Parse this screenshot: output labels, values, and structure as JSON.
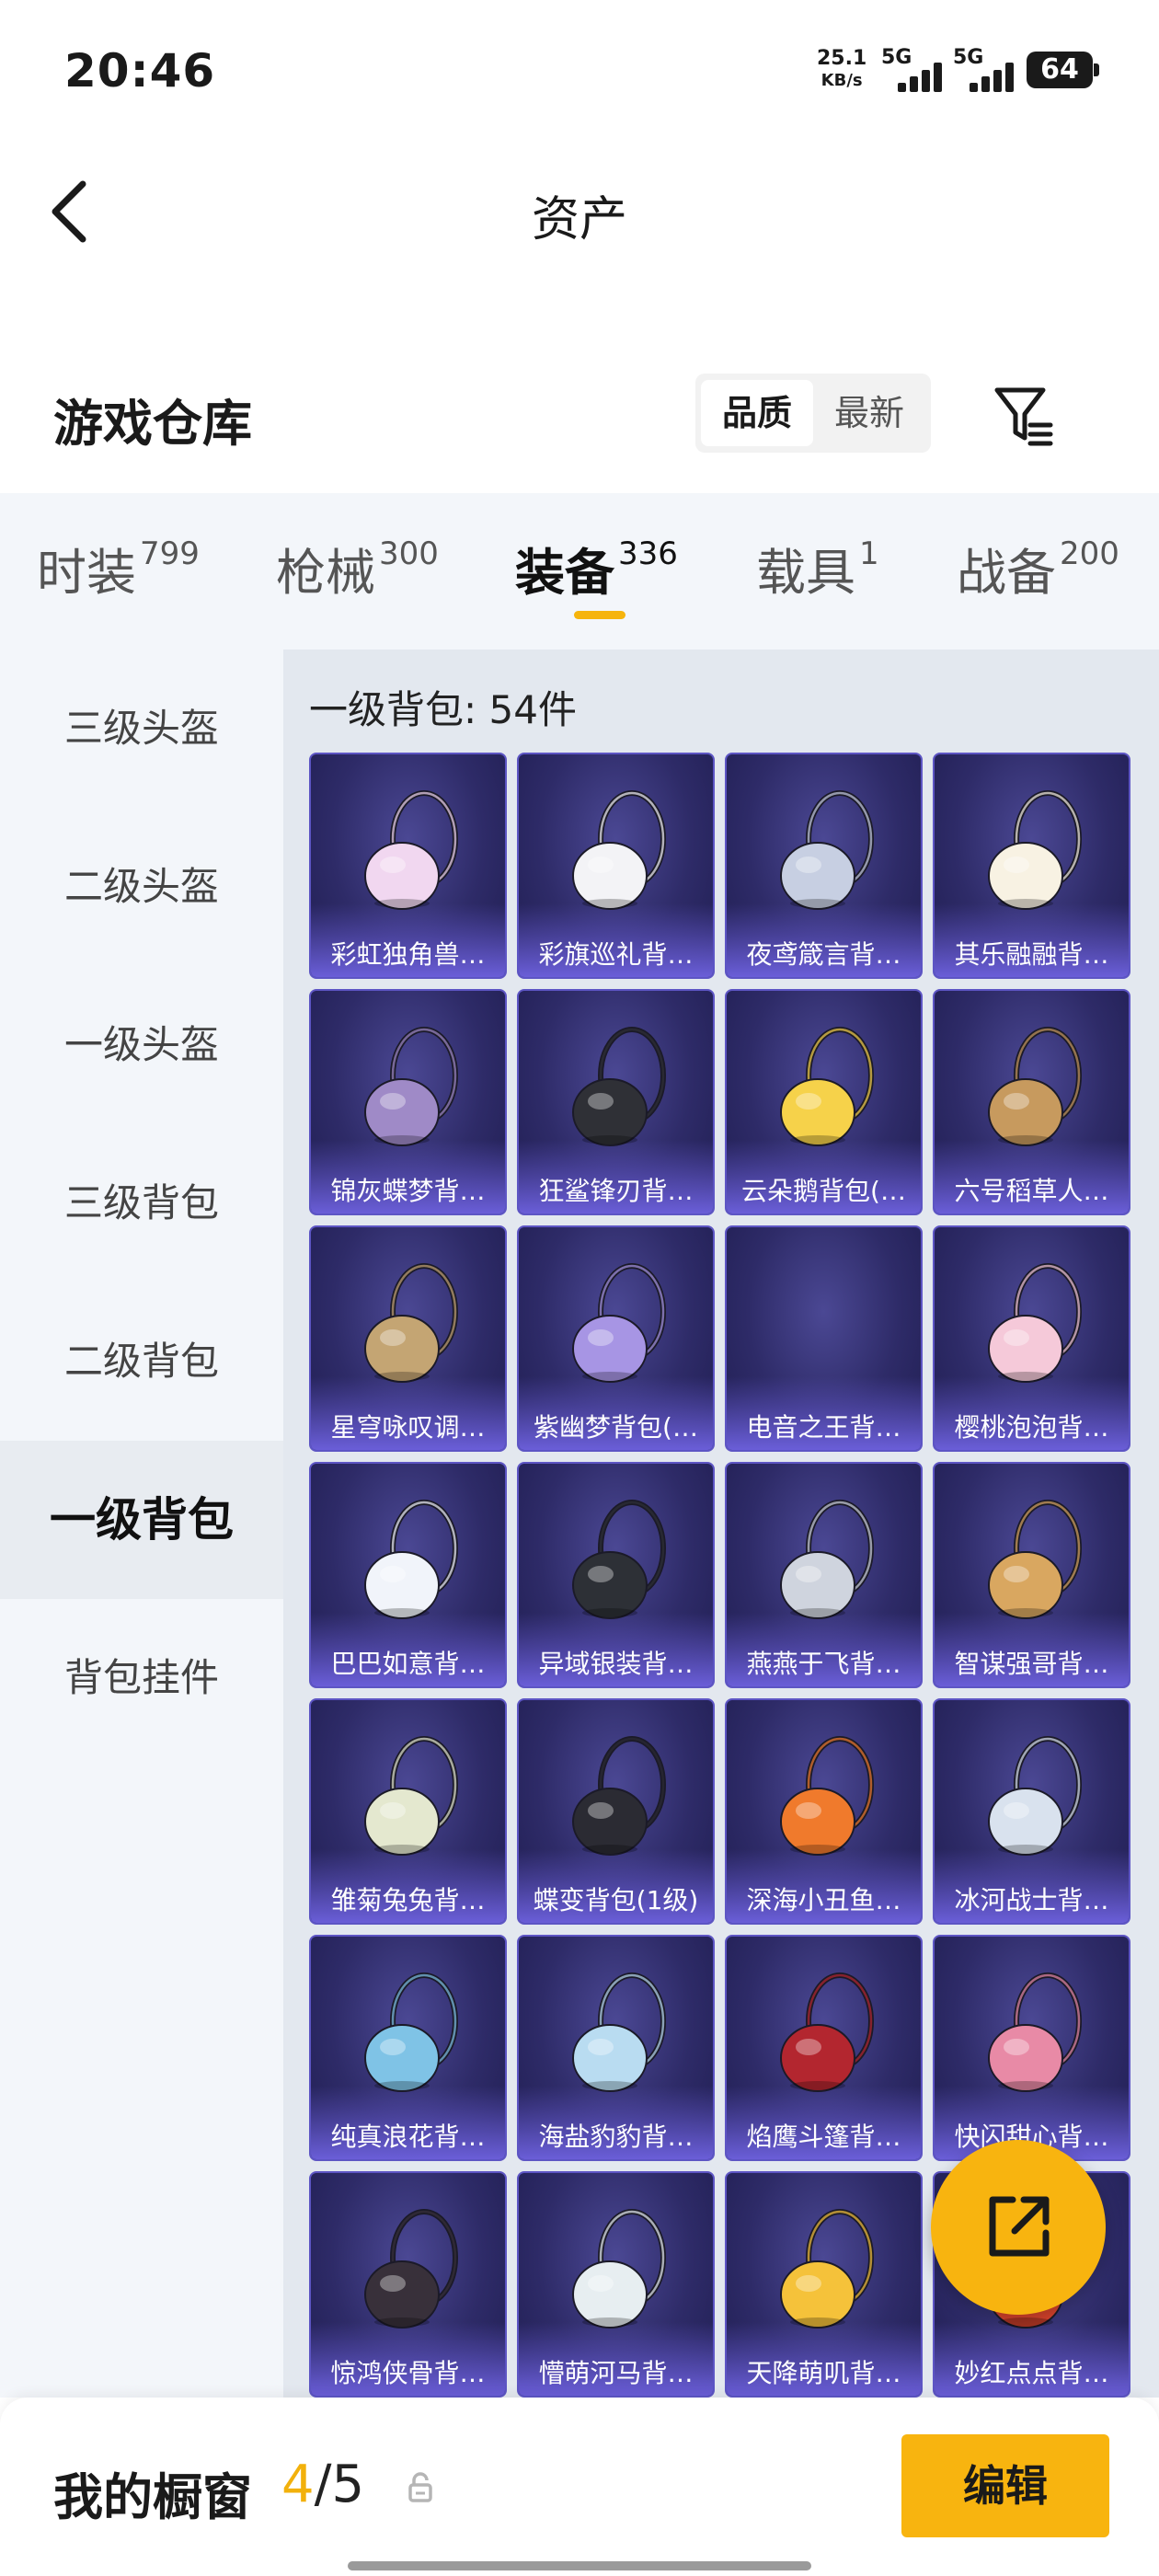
{
  "status_bar": {
    "time": "20:46",
    "net_speed_value": "25.1",
    "net_speed_unit": "KB/s",
    "sim1_label": "5G",
    "sim2_label": "5G",
    "battery": "64"
  },
  "header": {
    "title": "资产",
    "back_icon": "chevron-left-icon"
  },
  "section": {
    "title": "游戏仓库",
    "sort_options": [
      "品质",
      "最新"
    ],
    "active_sort": "品质",
    "filter_icon": "filter-icon"
  },
  "tabs": [
    {
      "label": "时装",
      "count": "799"
    },
    {
      "label": "枪械",
      "count": "300"
    },
    {
      "label": "装备",
      "count": "336"
    },
    {
      "label": "载具",
      "count": "1"
    },
    {
      "label": "战备",
      "count": "200"
    }
  ],
  "active_tab": "装备",
  "sidebar": {
    "items": [
      {
        "label": "三级头盔"
      },
      {
        "label": "二级头盔"
      },
      {
        "label": "一级头盔"
      },
      {
        "label": "三级背包"
      },
      {
        "label": "二级背包"
      },
      {
        "label": "一级背包"
      },
      {
        "label": "背包挂件"
      }
    ],
    "active": "一级背包"
  },
  "content": {
    "category": "一级背包",
    "count_text": "一级背包: 54件",
    "items": [
      {
        "name": "彩虹独角兽…",
        "color": "#f1d7f0"
      },
      {
        "name": "彩旗巡礼背…",
        "color": "#f3f3f6"
      },
      {
        "name": "夜鸢箴言背…",
        "color": "#c7cfe2"
      },
      {
        "name": "其乐融融背…",
        "color": "#f8f2e3"
      },
      {
        "name": "锦灰蝶梦背…",
        "color": "#9f8ac7"
      },
      {
        "name": "狂鲨锋刃背…",
        "color": "#2f3036"
      },
      {
        "name": "云朵鹅背包(…",
        "color": "#f6d24a"
      },
      {
        "name": "六号稻草人…",
        "color": "#c79a5e"
      },
      {
        "name": "星穹咏叹调…",
        "color": "#c4a573"
      },
      {
        "name": "紫幽梦背包(…",
        "color": "#a795e4"
      },
      {
        "name": "电音之王背…",
        "color": ""
      },
      {
        "name": "樱桃泡泡背…",
        "color": "#f5c9d9"
      },
      {
        "name": "巴巴如意背…",
        "color": "#f1f4fa"
      },
      {
        "name": "异域银装背…",
        "color": "#2d3036"
      },
      {
        "name": "燕燕于飞背…",
        "color": "#cfd4de"
      },
      {
        "name": "智谋强哥背…",
        "color": "#d9a760"
      },
      {
        "name": "雏菊兔兔背…",
        "color": "#e4e8cf"
      },
      {
        "name": "蝶变背包(1级)",
        "color": "#2b2b33"
      },
      {
        "name": "深海小丑鱼…",
        "color": "#f07a2c"
      },
      {
        "name": "冰河战士背…",
        "color": "#d9e2ee"
      },
      {
        "name": "纯真浪花背…",
        "color": "#7fc3e6"
      },
      {
        "name": "海盐豹豹背…",
        "color": "#b9dcf1"
      },
      {
        "name": "焰鹰斗篷背…",
        "color": "#b3262f"
      },
      {
        "name": "快闪甜心背…",
        "color": "#e88aa6"
      },
      {
        "name": "惊鸿侠骨背…",
        "color": "#38303a"
      },
      {
        "name": "懵萌河马背…",
        "color": "#e7eef1"
      },
      {
        "name": "天降萌叽背…",
        "color": "#f5c23a"
      },
      {
        "name": "妙红点点背…",
        "color": "#d8432c"
      }
    ]
  },
  "fab": {
    "icon": "share-icon"
  },
  "bottom_bar": {
    "label": "我的橱窗",
    "current": "4",
    "separator": "/",
    "max": "5",
    "lock_icon": "lock-icon",
    "edit_label": "编辑"
  }
}
